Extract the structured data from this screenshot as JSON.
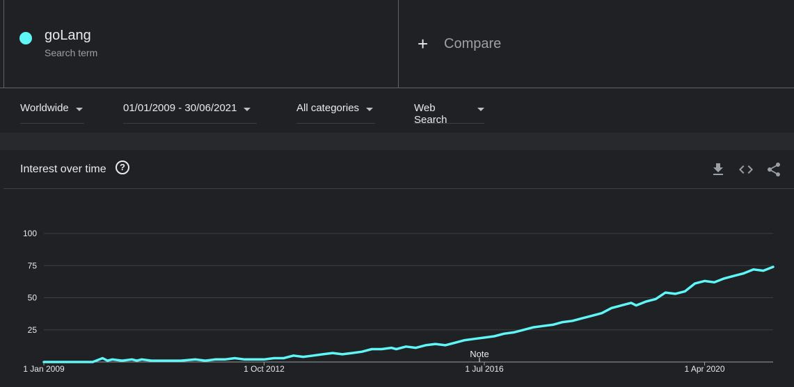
{
  "term": {
    "name": "goLang",
    "subtitle": "Search term",
    "color": "#5ff6f8"
  },
  "compare": {
    "label": "Compare"
  },
  "filters": {
    "region": "Worldwide",
    "date_range": "01/01/2009 - 30/06/2021",
    "category": "All categories",
    "search_type": "Web Search"
  },
  "card": {
    "title": "Interest over time",
    "help": "?",
    "icons": [
      "download-icon",
      "embed-icon",
      "share-icon"
    ]
  },
  "chart_data": {
    "type": "line",
    "title": "Interest over time",
    "xlabel": "",
    "ylabel": "",
    "x_range": [
      "2009-01",
      "2021-06"
    ],
    "ylim": [
      0,
      100
    ],
    "yticks": [
      "100",
      "75",
      "50",
      "25"
    ],
    "xticks": [
      "1 Jan 2009",
      "1 Oct 2012",
      "1 Jul 2016",
      "1 Apr 2020"
    ],
    "annotation": "Note",
    "grid": true,
    "series": [
      {
        "name": "goLang",
        "color": "#5ff6f8",
        "points": [
          [
            "2009-01",
            0
          ],
          [
            "2009-06",
            0
          ],
          [
            "2009-11",
            0
          ],
          [
            "2010-01",
            3
          ],
          [
            "2010-02",
            1
          ],
          [
            "2010-03",
            2
          ],
          [
            "2010-05",
            1
          ],
          [
            "2010-07",
            2
          ],
          [
            "2010-08",
            1
          ],
          [
            "2010-09",
            2
          ],
          [
            "2010-11",
            1
          ],
          [
            "2011-01",
            1
          ],
          [
            "2011-05",
            1
          ],
          [
            "2011-08",
            2
          ],
          [
            "2011-10",
            1
          ],
          [
            "2011-12",
            2
          ],
          [
            "2012-02",
            2
          ],
          [
            "2012-04",
            3
          ],
          [
            "2012-06",
            2
          ],
          [
            "2012-08",
            2
          ],
          [
            "2012-10",
            2
          ],
          [
            "2012-12",
            3
          ],
          [
            "2013-02",
            3
          ],
          [
            "2013-04",
            5
          ],
          [
            "2013-06",
            4
          ],
          [
            "2013-08",
            5
          ],
          [
            "2013-10",
            6
          ],
          [
            "2013-12",
            7
          ],
          [
            "2014-02",
            6
          ],
          [
            "2014-04",
            7
          ],
          [
            "2014-06",
            8
          ],
          [
            "2014-08",
            10
          ],
          [
            "2014-10",
            10
          ],
          [
            "2014-12",
            11
          ],
          [
            "2015-01",
            10
          ],
          [
            "2015-03",
            12
          ],
          [
            "2015-05",
            11
          ],
          [
            "2015-07",
            13
          ],
          [
            "2015-09",
            14
          ],
          [
            "2015-11",
            13
          ],
          [
            "2016-01",
            15
          ],
          [
            "2016-03",
            17
          ],
          [
            "2016-05",
            18
          ],
          [
            "2016-07",
            19
          ],
          [
            "2016-09",
            20
          ],
          [
            "2016-11",
            22
          ],
          [
            "2017-01",
            23
          ],
          [
            "2017-03",
            25
          ],
          [
            "2017-05",
            27
          ],
          [
            "2017-07",
            28
          ],
          [
            "2017-09",
            29
          ],
          [
            "2017-11",
            31
          ],
          [
            "2018-01",
            32
          ],
          [
            "2018-03",
            34
          ],
          [
            "2018-05",
            36
          ],
          [
            "2018-07",
            38
          ],
          [
            "2018-09",
            42
          ],
          [
            "2018-11",
            44
          ],
          [
            "2019-01",
            46
          ],
          [
            "2019-02",
            44
          ],
          [
            "2019-04",
            47
          ],
          [
            "2019-06",
            49
          ],
          [
            "2019-08",
            54
          ],
          [
            "2019-10",
            53
          ],
          [
            "2019-12",
            55
          ],
          [
            "2020-02",
            61
          ],
          [
            "2020-04",
            63
          ],
          [
            "2020-06",
            62
          ],
          [
            "2020-08",
            65
          ],
          [
            "2020-10",
            67
          ],
          [
            "2020-12",
            69
          ],
          [
            "2021-02",
            72
          ],
          [
            "2021-04",
            71
          ],
          [
            "2021-06",
            74
          ]
        ]
      }
    ]
  }
}
